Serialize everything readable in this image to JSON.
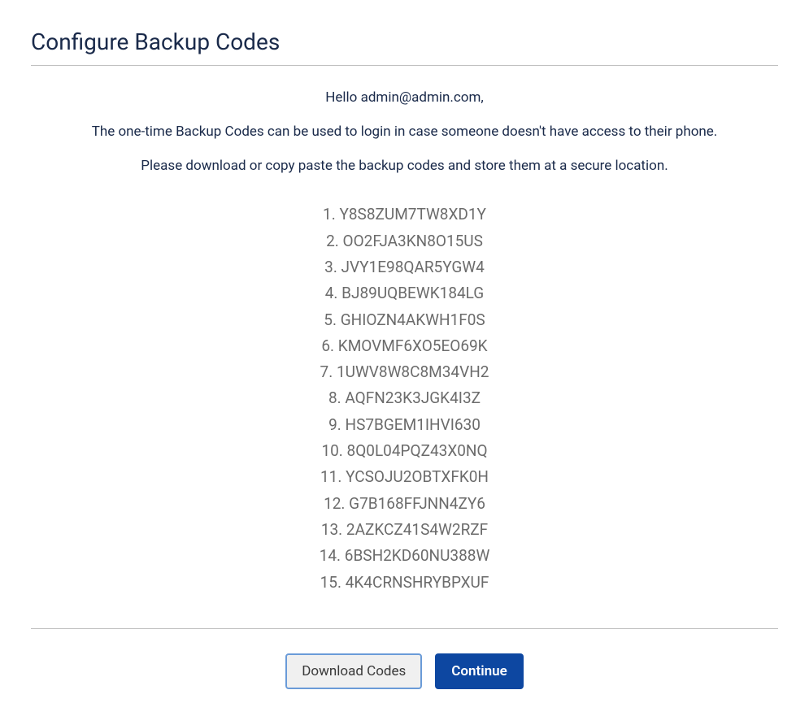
{
  "title": "Configure Backup Codes",
  "intro": {
    "greeting": "Hello admin@admin.com,",
    "line1": "The one-time Backup Codes can be used to login in case someone doesn't have access to their phone.",
    "line2": "Please download or copy paste the backup codes and store them at a secure location."
  },
  "codes": [
    "Y8S8ZUM7TW8XD1Y",
    "OO2FJA3KN8O15US",
    "JVY1E98QAR5YGW4",
    "BJ89UQBEWK184LG",
    "GHIOZN4AKWH1F0S",
    "KMOVMF6XO5EO69K",
    "1UWV8W8C8M34VH2",
    "AQFN23K3JGK4I3Z",
    "HS7BGEM1IHVI630",
    "8Q0L04PQZ43X0NQ",
    "YCSOJU2OBTXFK0H",
    "G7B168FFJNN4ZY6",
    "2AZKCZ41S4W2RZF",
    "6BSH2KD60NU388W",
    "4K4CRNSHRYBPXUF"
  ],
  "buttons": {
    "download": "Download Codes",
    "continue": "Continue"
  }
}
